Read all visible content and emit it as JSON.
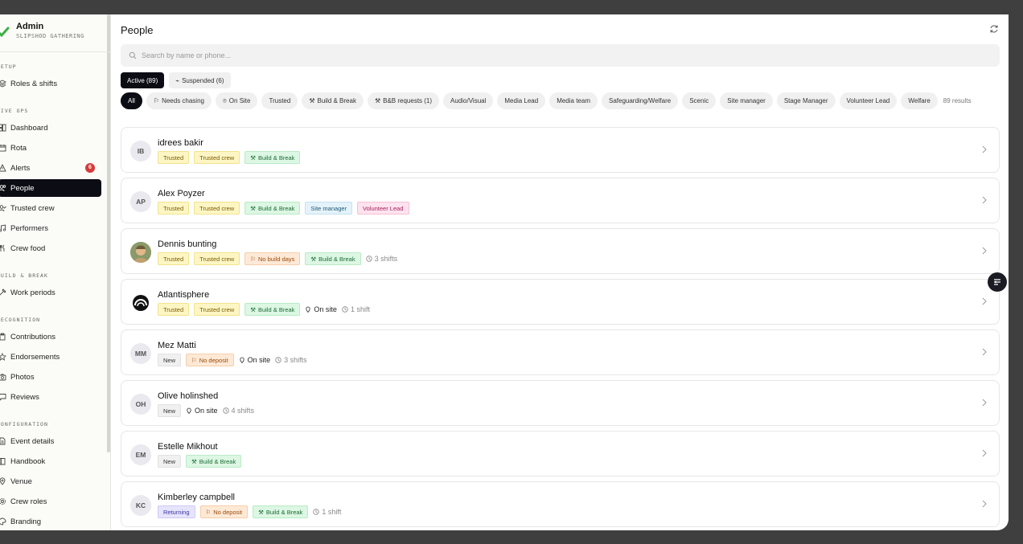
{
  "brand": {
    "title": "Admin",
    "subtitle": "SLIPSHOD GATHERING"
  },
  "sidebar": {
    "sections": {
      "setup": "SETUP",
      "live_ops": "LIVE OPS",
      "build_break": "BUILD & BREAK",
      "recognition": "RECOGNITION",
      "configuration": "CONFIGURATION"
    },
    "items": {
      "roles_shifts": "Roles & shifts",
      "dashboard": "Dashboard",
      "rota": "Rota",
      "alerts": "Alerts",
      "alerts_count": "6",
      "people": "People",
      "trusted_crew": "Trusted crew",
      "performers": "Performers",
      "crew_food": "Crew food",
      "work_periods": "Work periods",
      "contributions": "Contributions",
      "endorsements": "Endorsements",
      "photos": "Photos",
      "reviews": "Reviews",
      "event_details": "Event details",
      "handbook": "Handbook",
      "venue": "Venue",
      "crew_roles": "Crew roles",
      "branding": "Branding"
    }
  },
  "header": {
    "title": "People"
  },
  "search": {
    "placeholder": "Search by name or phone..."
  },
  "tabs": {
    "active": "Active (89)",
    "suspended": "Suspended (6)"
  },
  "filters": {
    "all": "All",
    "needs_chasing": "Needs chasing",
    "on_site": "On Site",
    "trusted": "Trusted",
    "build_break": "Build & Break",
    "bb_requests": "B&B requests (1)",
    "audio_visual": "Audio/Visual",
    "media_lead": "Media Lead",
    "media_team": "Media team",
    "safeguarding": "Safeguarding/Welfare",
    "scenic": "Scenic",
    "site_manager": "Site manager",
    "stage_manager": "Stage Manager",
    "volunteer_lead": "Volunteer Lead",
    "welfare": "Welfare",
    "results": "89 results"
  },
  "people": [
    {
      "initials": "IB",
      "name": "idrees bakir",
      "tags": [
        "Trusted",
        "Trusted crew",
        "Build & Break"
      ]
    },
    {
      "initials": "AP",
      "name": "Alex Poyzer",
      "tags": [
        "Trusted",
        "Trusted crew",
        "Build & Break",
        "Site manager",
        "Volunteer Lead"
      ]
    },
    {
      "initials": "",
      "name": "Dennis bunting",
      "tags": [
        "Trusted",
        "Trusted crew",
        "No build days",
        "Build & Break"
      ],
      "shifts": "3 shifts"
    },
    {
      "initials": "",
      "name": "Atlantisphere",
      "tags": [
        "Trusted",
        "Trusted crew",
        "Build & Break"
      ],
      "on_site": "On site",
      "shifts": "1 shift"
    },
    {
      "initials": "MM",
      "name": "Mez Matti",
      "tags": [
        "New",
        "No deposit"
      ],
      "on_site": "On site",
      "shifts": "3 shifts"
    },
    {
      "initials": "OH",
      "name": "Olive holinshed",
      "tags": [
        "New"
      ],
      "on_site": "On site",
      "shifts": "4 shifts"
    },
    {
      "initials": "EM",
      "name": "Estelle Mikhout",
      "tags": [
        "New",
        "Build & Break"
      ]
    },
    {
      "initials": "KC",
      "name": "Kimberley campbell",
      "tags": [
        "Returning",
        "No deposit",
        "Build & Break"
      ],
      "shifts": "1 shift"
    }
  ],
  "colors": {
    "accent_dark": "#0c0c14",
    "alert_red": "#d63a3a",
    "brand_green": "#3cb043"
  }
}
